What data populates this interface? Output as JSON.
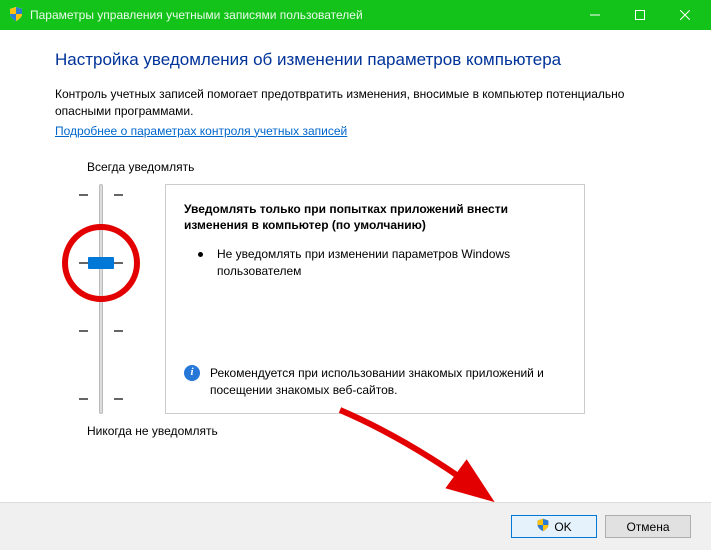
{
  "window": {
    "title": "Параметры управления учетными записями пользователей"
  },
  "heading": "Настройка уведомления об изменении параметров компьютера",
  "description": "Контроль учетных записей помогает предотвратить изменения, вносимые в компьютер потенциально опасными программами.",
  "link": "Подробнее о параметрах контроля учетных записей",
  "slider": {
    "top_label": "Всегда уведомлять",
    "bottom_label": "Никогда не уведомлять",
    "levels": 4,
    "selected_index": 1
  },
  "info": {
    "title": "Уведомлять только при попытках приложений внести изменения в компьютер (по умолчанию)",
    "bullet": "Не уведомлять при изменении параметров Windows пользователем",
    "recommend": "Рекомендуется при использовании знакомых приложений и посещении знакомых веб-сайтов."
  },
  "buttons": {
    "ok": "OK",
    "cancel": "Отмена"
  }
}
